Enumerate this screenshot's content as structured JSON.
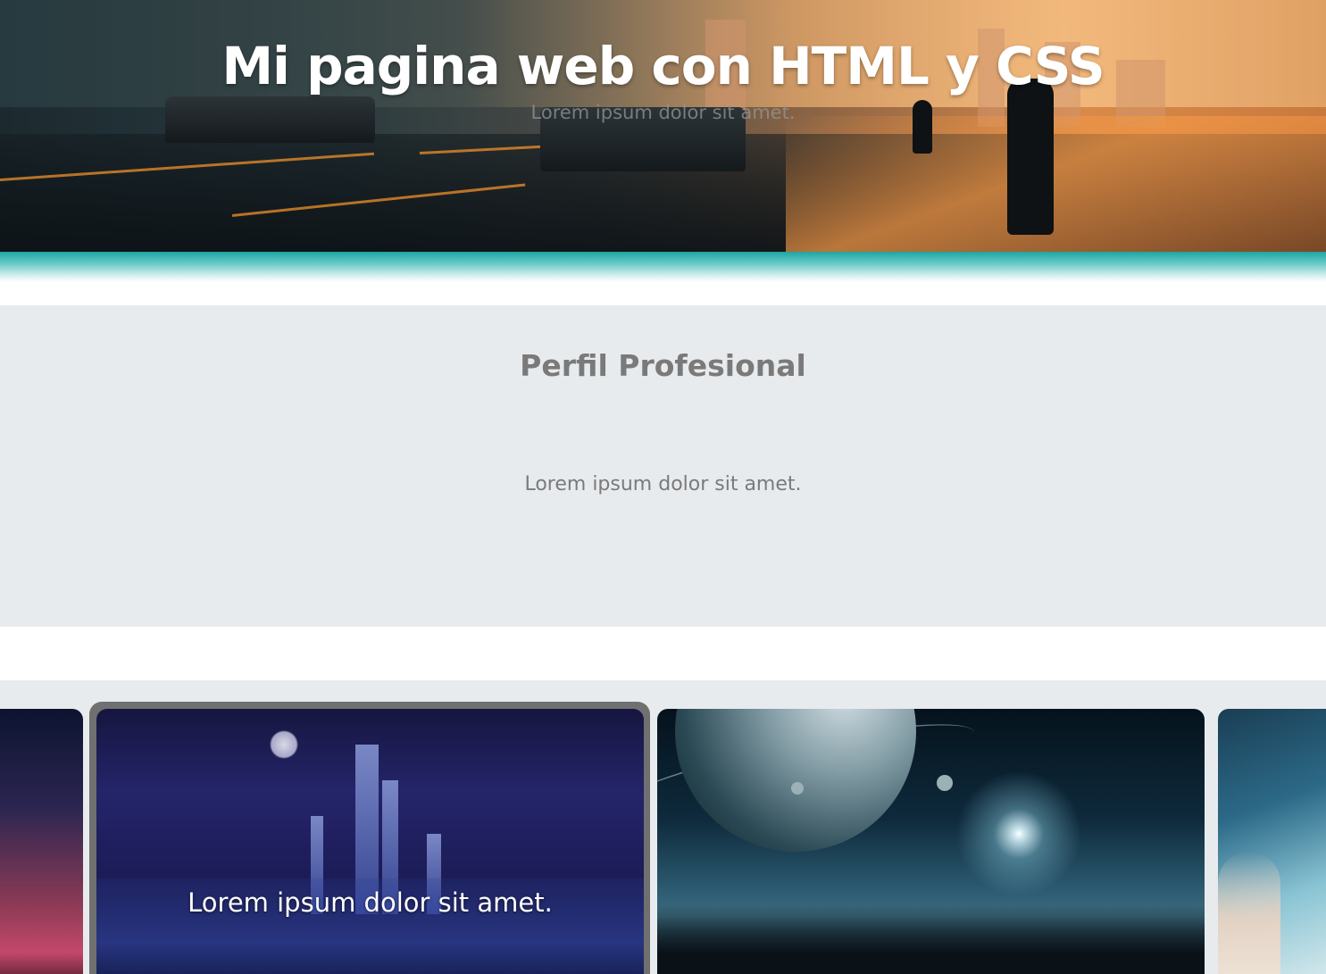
{
  "header": {
    "title": "Mi pagina web con HTML y CSS",
    "subtitle": "Lorem ipsum dolor sit amet."
  },
  "profile": {
    "title": "Perfil Profesional",
    "text": "Lorem ipsum dolor sit amet."
  },
  "gallery": {
    "cards": [
      {
        "caption": ""
      },
      {
        "caption": "Lorem ipsum dolor sit amet."
      },
      {
        "caption": ""
      },
      {
        "caption": ""
      }
    ]
  },
  "colors": {
    "accent_teal": "#1fa5a2",
    "section_bg": "#e8ebee",
    "muted_text": "#7a7a7a"
  }
}
